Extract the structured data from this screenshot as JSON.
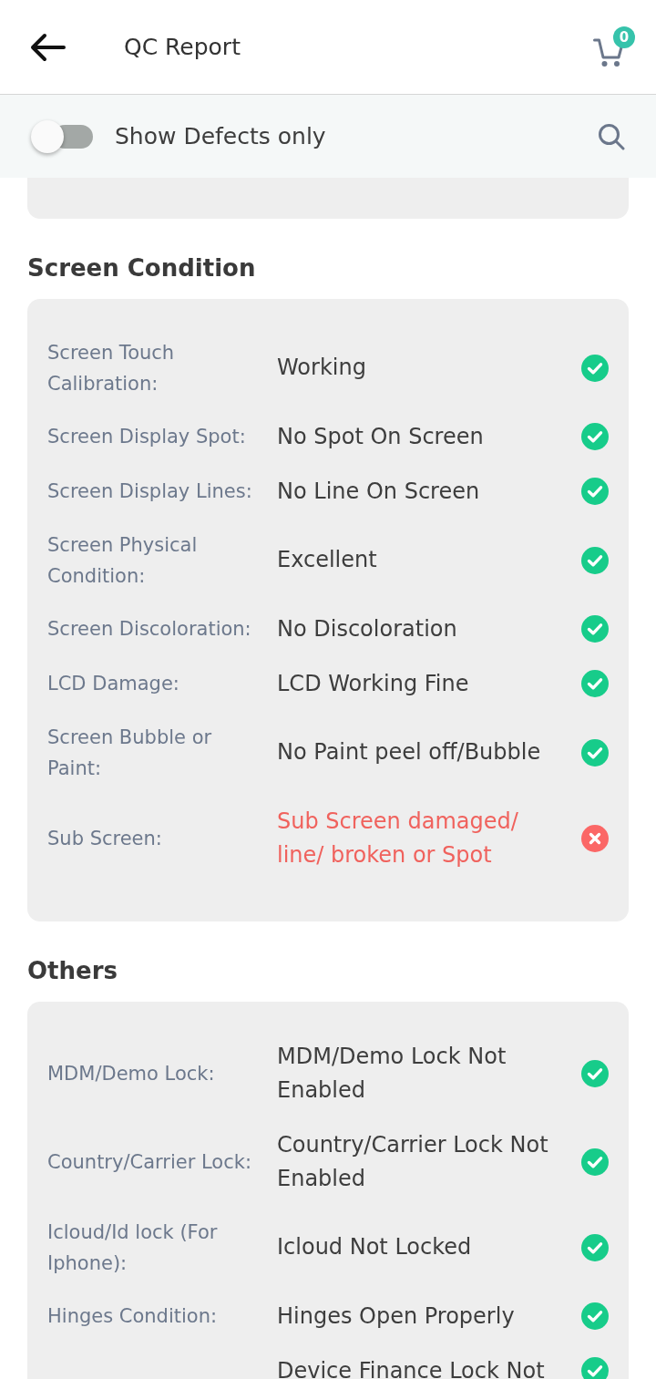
{
  "header": {
    "title": "QC Report",
    "cart_badge": "0"
  },
  "filter_bar": {
    "label": "Show Defects only",
    "on": false
  },
  "sections": [
    {
      "title": "Screen Condition",
      "rows": [
        {
          "label": "Screen Touch Calibration:",
          "value": "Working",
          "passed": true
        },
        {
          "label": "Screen Display Spot:",
          "value": "No Spot On Screen",
          "passed": true
        },
        {
          "label": "Screen Display Lines:",
          "value": "No Line On Screen",
          "passed": true
        },
        {
          "label": "Screen Physical Condition:",
          "value": "Excellent",
          "passed": true
        },
        {
          "label": "Screen Discoloration:",
          "value": "No Discoloration",
          "passed": true
        },
        {
          "label": "LCD Damage:",
          "value": "LCD Working Fine",
          "passed": true
        },
        {
          "label": "Screen Bubble or Paint:",
          "value": "No Paint peel off/Bubble",
          "passed": true
        },
        {
          "label": "Sub Screen:",
          "value": "Sub Screen damaged/ line/ broken or Spot",
          "passed": false
        }
      ]
    },
    {
      "title": "Others",
      "rows": [
        {
          "label": "MDM/Demo Lock:",
          "value": "MDM/Demo Lock Not Enabled",
          "passed": true
        },
        {
          "label": "Country/Carrier Lock:",
          "value": "Country/Carrier Lock Not Enabled",
          "passed": true
        },
        {
          "label": "Icloud/Id lock (For Iphone):",
          "value": "Icloud Not Locked",
          "passed": true
        },
        {
          "label": "Hinges Condition:",
          "value": "Hinges Open Properly",
          "passed": true
        },
        {
          "value": "Device Finance Lock Not",
          "passed": true
        }
      ]
    }
  ]
}
